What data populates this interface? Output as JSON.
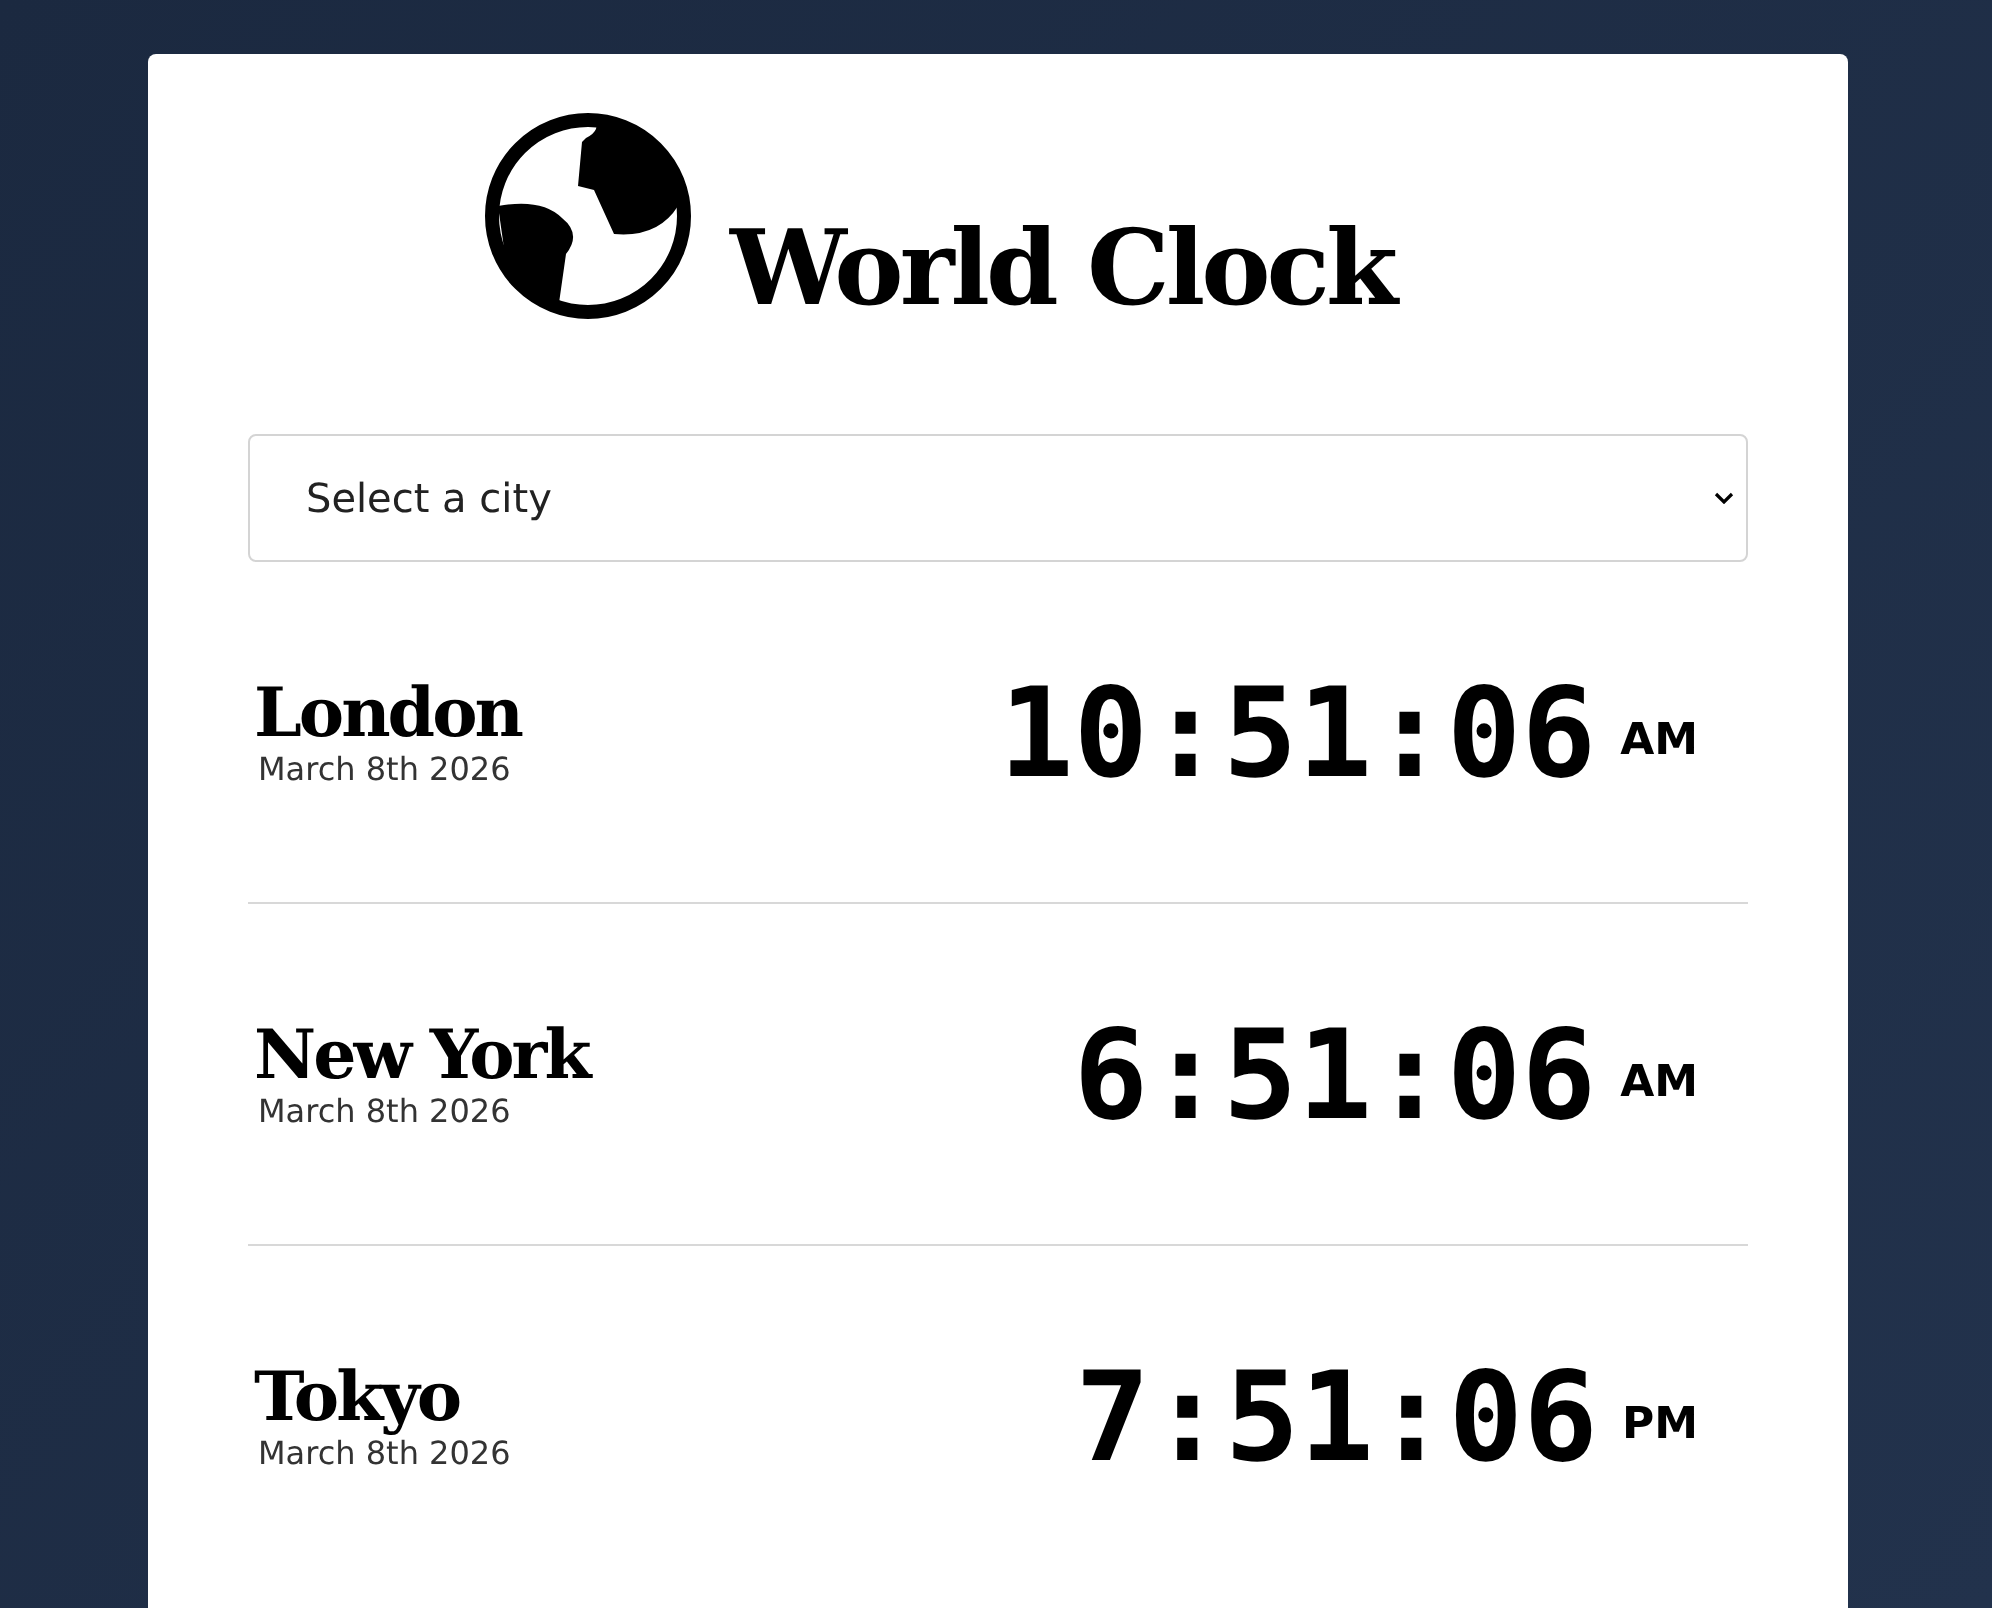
{
  "title": "World Clock",
  "city_select": {
    "placeholder": "Select a city"
  },
  "cities": [
    {
      "name": "London",
      "date": "March 8th 2026",
      "time": "10:51:06",
      "period": "AM"
    },
    {
      "name": "New York",
      "date": "March 8th 2026",
      "time": "6:51:06",
      "period": "AM"
    },
    {
      "name": "Tokyo",
      "date": "March 8th 2026",
      "time": "7:51:06",
      "period": "PM"
    }
  ]
}
